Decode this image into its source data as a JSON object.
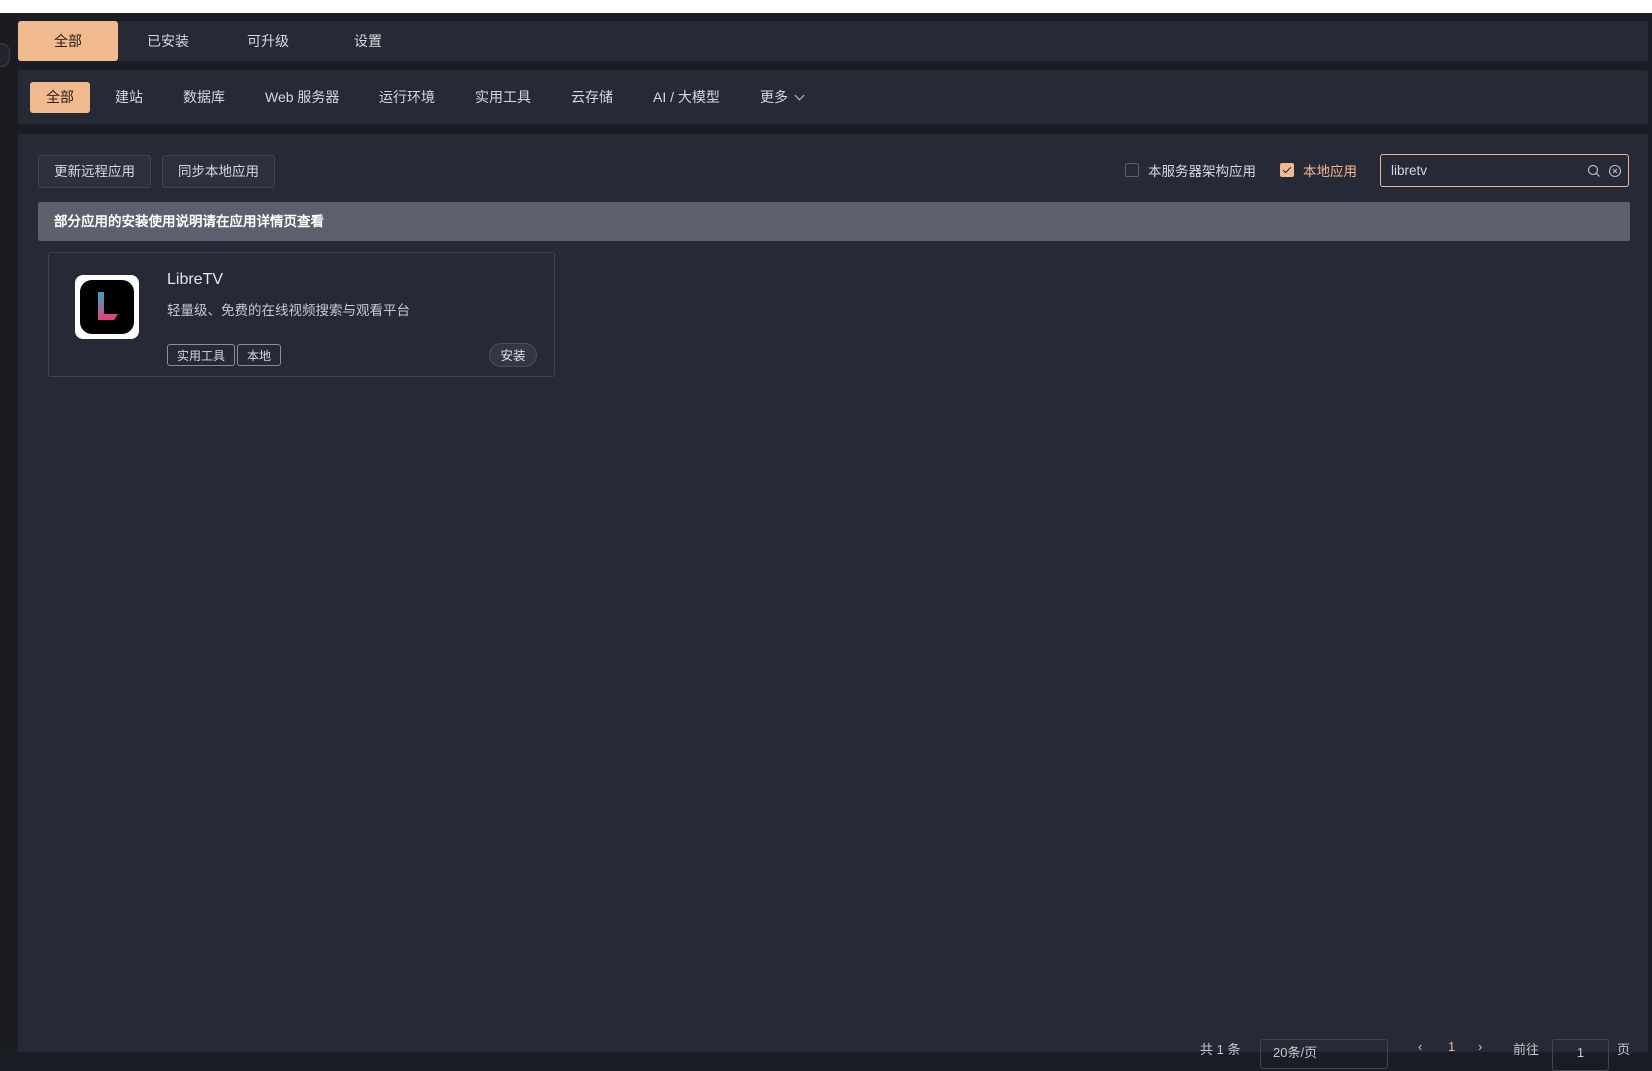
{
  "tabs": [
    "全部",
    "已安装",
    "可升级",
    "设置"
  ],
  "categories": [
    "全部",
    "建站",
    "数据库",
    "Web 服务器",
    "运行环境",
    "实用工具",
    "云存储",
    "AI / 大模型",
    "更多"
  ],
  "toolbar": {
    "update_remote": "更新远程应用",
    "sync_local": "同步本地应用",
    "arch_filter": "本服务器架构应用",
    "local_filter": "本地应用",
    "search_value": "libretv"
  },
  "notice": "部分应用的安装使用说明请在应用详情页查看",
  "app": {
    "name": "LibreTV",
    "description": "轻量级、免费的在线视频搜索与观看平台",
    "tags": [
      "实用工具",
      "本地"
    ],
    "install_label": "安装"
  },
  "pagination": {
    "total_text": "共 1 条",
    "page_size": "20条/页",
    "current_page": "1",
    "goto_label": "前往",
    "goto_value": "1",
    "page_unit": "页"
  },
  "colors": {
    "accent": "#f1b98e",
    "background": "#1b1d24",
    "panel": "#262a36",
    "notice": "#5c606d"
  },
  "filters_checked": {
    "arch": false,
    "local": true
  }
}
